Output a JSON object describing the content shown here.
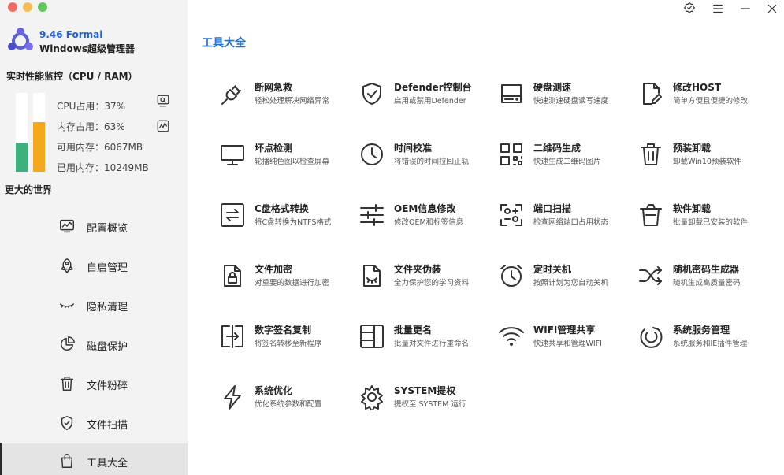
{
  "app": {
    "version": "9.46 Formal",
    "name": "Windows超级管理器"
  },
  "colors": {
    "accent": "#1f6fe0",
    "cpu_bar": "#3bb27b",
    "mem_bar": "#f5a81c",
    "traffic_red": "#f26b5e",
    "traffic_yellow": "#f7bc4c",
    "traffic_green": "#5fc95a"
  },
  "performance": {
    "title": "实时性能监控（CPU / RAM）",
    "cpu_label": "CPU占用：37%",
    "cpu_percent": 37,
    "mem_label": "内存占用：63%",
    "mem_percent": 63,
    "avail_label": "可用内存：6067MB",
    "used_label": "已用内存：10249MB",
    "icons": [
      "monitor-search-icon",
      "chart-icon"
    ]
  },
  "sidebar": {
    "section_title": "更大的世界",
    "items": [
      {
        "label": "配置概览",
        "icon": "monitor-chart-icon"
      },
      {
        "label": "自启管理",
        "icon": "rocket-icon"
      },
      {
        "label": "隐私清理",
        "icon": "eye-closed-icon"
      },
      {
        "label": "磁盘保护",
        "icon": "pie-chart-icon"
      },
      {
        "label": "文件粉碎",
        "icon": "trash-icon"
      },
      {
        "label": "文件扫描",
        "icon": "shield-check-icon"
      },
      {
        "label": "工具大全",
        "icon": "bag-icon",
        "active": true
      }
    ]
  },
  "window_controls": [
    "settings-icon",
    "menu-icon",
    "minimize-icon",
    "close-icon"
  ],
  "main": {
    "title": "工具大全",
    "tools": [
      {
        "name": "断网急救",
        "desc": "轻松处理解决网络异常",
        "icon": "plug-icon"
      },
      {
        "name": "Defender控制台",
        "desc": "启用或禁用Defender",
        "icon": "shield-check-icon"
      },
      {
        "name": "硬盘测速",
        "desc": "快速测速硬盘读写速度",
        "icon": "hard-drive-icon"
      },
      {
        "name": "修改HOST",
        "desc": "简单方便且便捷的修改",
        "icon": "file-edit-icon"
      },
      {
        "name": "坏点检测",
        "desc": "轮播纯色图以检查屏幕",
        "icon": "monitor-icon"
      },
      {
        "name": "时间校准",
        "desc": "将错误的时间拉回正轨",
        "icon": "clock-icon"
      },
      {
        "name": "二维码生成",
        "desc": "快速生成二维码图片",
        "icon": "qrcode-icon"
      },
      {
        "name": "预装卸载",
        "desc": "卸载Win10预装软件",
        "icon": "trash-icon"
      },
      {
        "name": "C盘格式转换",
        "desc": "将C盘转换为NTFS格式",
        "icon": "convert-icon"
      },
      {
        "name": "OEM信息修改",
        "desc": "修改OEM和标签信息",
        "icon": "sliders-icon"
      },
      {
        "name": "端口扫描",
        "desc": "检查网络端口占用状态",
        "icon": "scan-icon"
      },
      {
        "name": "软件卸载",
        "desc": "批量卸载已安装的软件",
        "icon": "trash-can-icon"
      },
      {
        "name": "文件加密",
        "desc": "对重要的数据进行加密",
        "icon": "file-lock-icon"
      },
      {
        "name": "文件夹伪装",
        "desc": "全力保护您的学习资料",
        "icon": "file-hidden-icon"
      },
      {
        "name": "定时关机",
        "desc": "按照计划为您自动关机",
        "icon": "alarm-clock-icon"
      },
      {
        "name": "随机密码生成器",
        "desc": "随机生成高质量密码",
        "icon": "shuffle-icon"
      },
      {
        "name": "数字签名复制",
        "desc": "将签名转移至新程序",
        "icon": "signature-copy-icon"
      },
      {
        "name": "批量更名",
        "desc": "批量对文件进行重命名",
        "icon": "rename-icon"
      },
      {
        "name": "WIFI管理共享",
        "desc": "快速共享和管理WIFI",
        "icon": "wifi-icon"
      },
      {
        "name": "系统服务管理",
        "desc": "系统服务和IE插件管理",
        "icon": "service-ring-icon"
      },
      {
        "name": "系统优化",
        "desc": "优化系统参数和配置",
        "icon": "lightning-icon"
      },
      {
        "name": "SYSTEM提权",
        "desc": "提权至 SYSTEM 运行",
        "icon": "gear-icon"
      }
    ]
  }
}
